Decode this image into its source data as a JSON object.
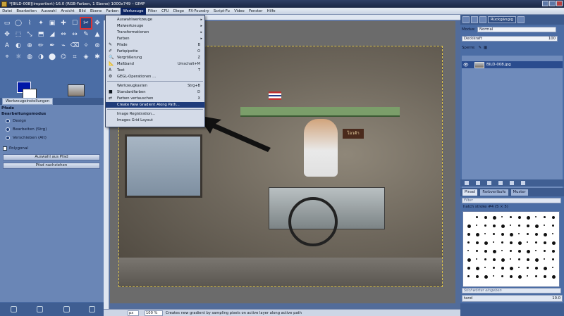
{
  "window": {
    "title": "*[BILD-008](importiert)-16.0 (RGB-Farben, 1 Ebene) 1000x749 – GIMP"
  },
  "menubar": [
    "Datei",
    "Bearbeiten",
    "Auswahl",
    "Ansicht",
    "Bild",
    "Ebene",
    "Farben",
    "Werkzeuge",
    "Filter",
    "CFU",
    "Diego",
    "FX-Foundry",
    "Script-Fu",
    "Video",
    "Fenster",
    "Hilfe"
  ],
  "menu_active_index": 7,
  "dropdown": {
    "items": [
      {
        "label": "Auswahlwerkzeuge",
        "shortcut": "",
        "submenu": true,
        "icon": ""
      },
      {
        "label": "Malwerkzeuge",
        "shortcut": "",
        "submenu": true,
        "icon": ""
      },
      {
        "label": "Transformationen",
        "shortcut": "",
        "submenu": true,
        "icon": ""
      },
      {
        "label": "Farben",
        "shortcut": "",
        "submenu": true,
        "icon": ""
      },
      {
        "label": "Pfade",
        "shortcut": "B",
        "submenu": false,
        "icon": "✎"
      },
      {
        "label": "Farbpipette",
        "shortcut": "O",
        "submenu": false,
        "icon": "✐"
      },
      {
        "label": "Vergrößerung",
        "shortcut": "Z",
        "submenu": false,
        "icon": "🔍"
      },
      {
        "label": "Maßband",
        "shortcut": "Umschalt+M",
        "submenu": false,
        "icon": "📐"
      },
      {
        "label": "Text",
        "shortcut": "T",
        "submenu": false,
        "icon": "A"
      },
      {
        "label": "GEGL-Operationen ...",
        "shortcut": "",
        "submenu": false,
        "icon": "⚙"
      },
      {
        "label": "Werkzeugkasten",
        "shortcut": "Strg+B",
        "submenu": false,
        "icon": ""
      },
      {
        "label": "Standardfarben",
        "shortcut": "D",
        "submenu": false,
        "icon": "■"
      },
      {
        "label": "Farben vertauschen",
        "shortcut": "X",
        "submenu": false,
        "icon": "⇄"
      },
      {
        "label": "Create New Gradient Along Path...",
        "shortcut": "",
        "submenu": false,
        "icon": "",
        "highlighted": true
      },
      {
        "label": "Image Registration...",
        "shortcut": "",
        "submenu": false,
        "icon": ""
      },
      {
        "label": "Images Grid Layout",
        "shortcut": "",
        "submenu": false,
        "icon": ""
      }
    ]
  },
  "toolbox": {
    "tab_label": "Werkzeugeinstellungen",
    "options": {
      "title": "Pfade",
      "mode_label": "Bearbeitungsmodus",
      "modes": [
        "Design",
        "Bearbeiten (Strg)",
        "Verschieben (Alt)"
      ],
      "polygonal": "Polygonal",
      "btn_selection": "Auswahl aus Pfad",
      "btn_stroke": "Pfad nachziehen"
    }
  },
  "image": {
    "sign_text": "โอวต้า"
  },
  "status": {
    "unit": "px",
    "zoom": "100 %",
    "message": "Creates new gradient by sampling pixels on active layer along active path"
  },
  "dock": {
    "undo_label": "Rückgängig",
    "mode_label": "Modus:",
    "mode_value": "Normal",
    "opacity_label": "Deckkraft",
    "opacity_value": "100",
    "lock_label": "Sperre:",
    "layer_name": "BILD-008.jpg",
    "tabs": [
      "Pinsel",
      "Farbverläufe",
      "Muster"
    ],
    "filter_placeholder": "Filter",
    "brush_name": "hatch stroke #4 (5 × 5)",
    "tag_placeholder": "Stichwörter eingeben",
    "spacing_label": "tand",
    "spacing_value": "10.0"
  },
  "colors": {
    "foreground": "#0018a8",
    "background": "#ffffff",
    "accent": "#1e3b7a"
  }
}
